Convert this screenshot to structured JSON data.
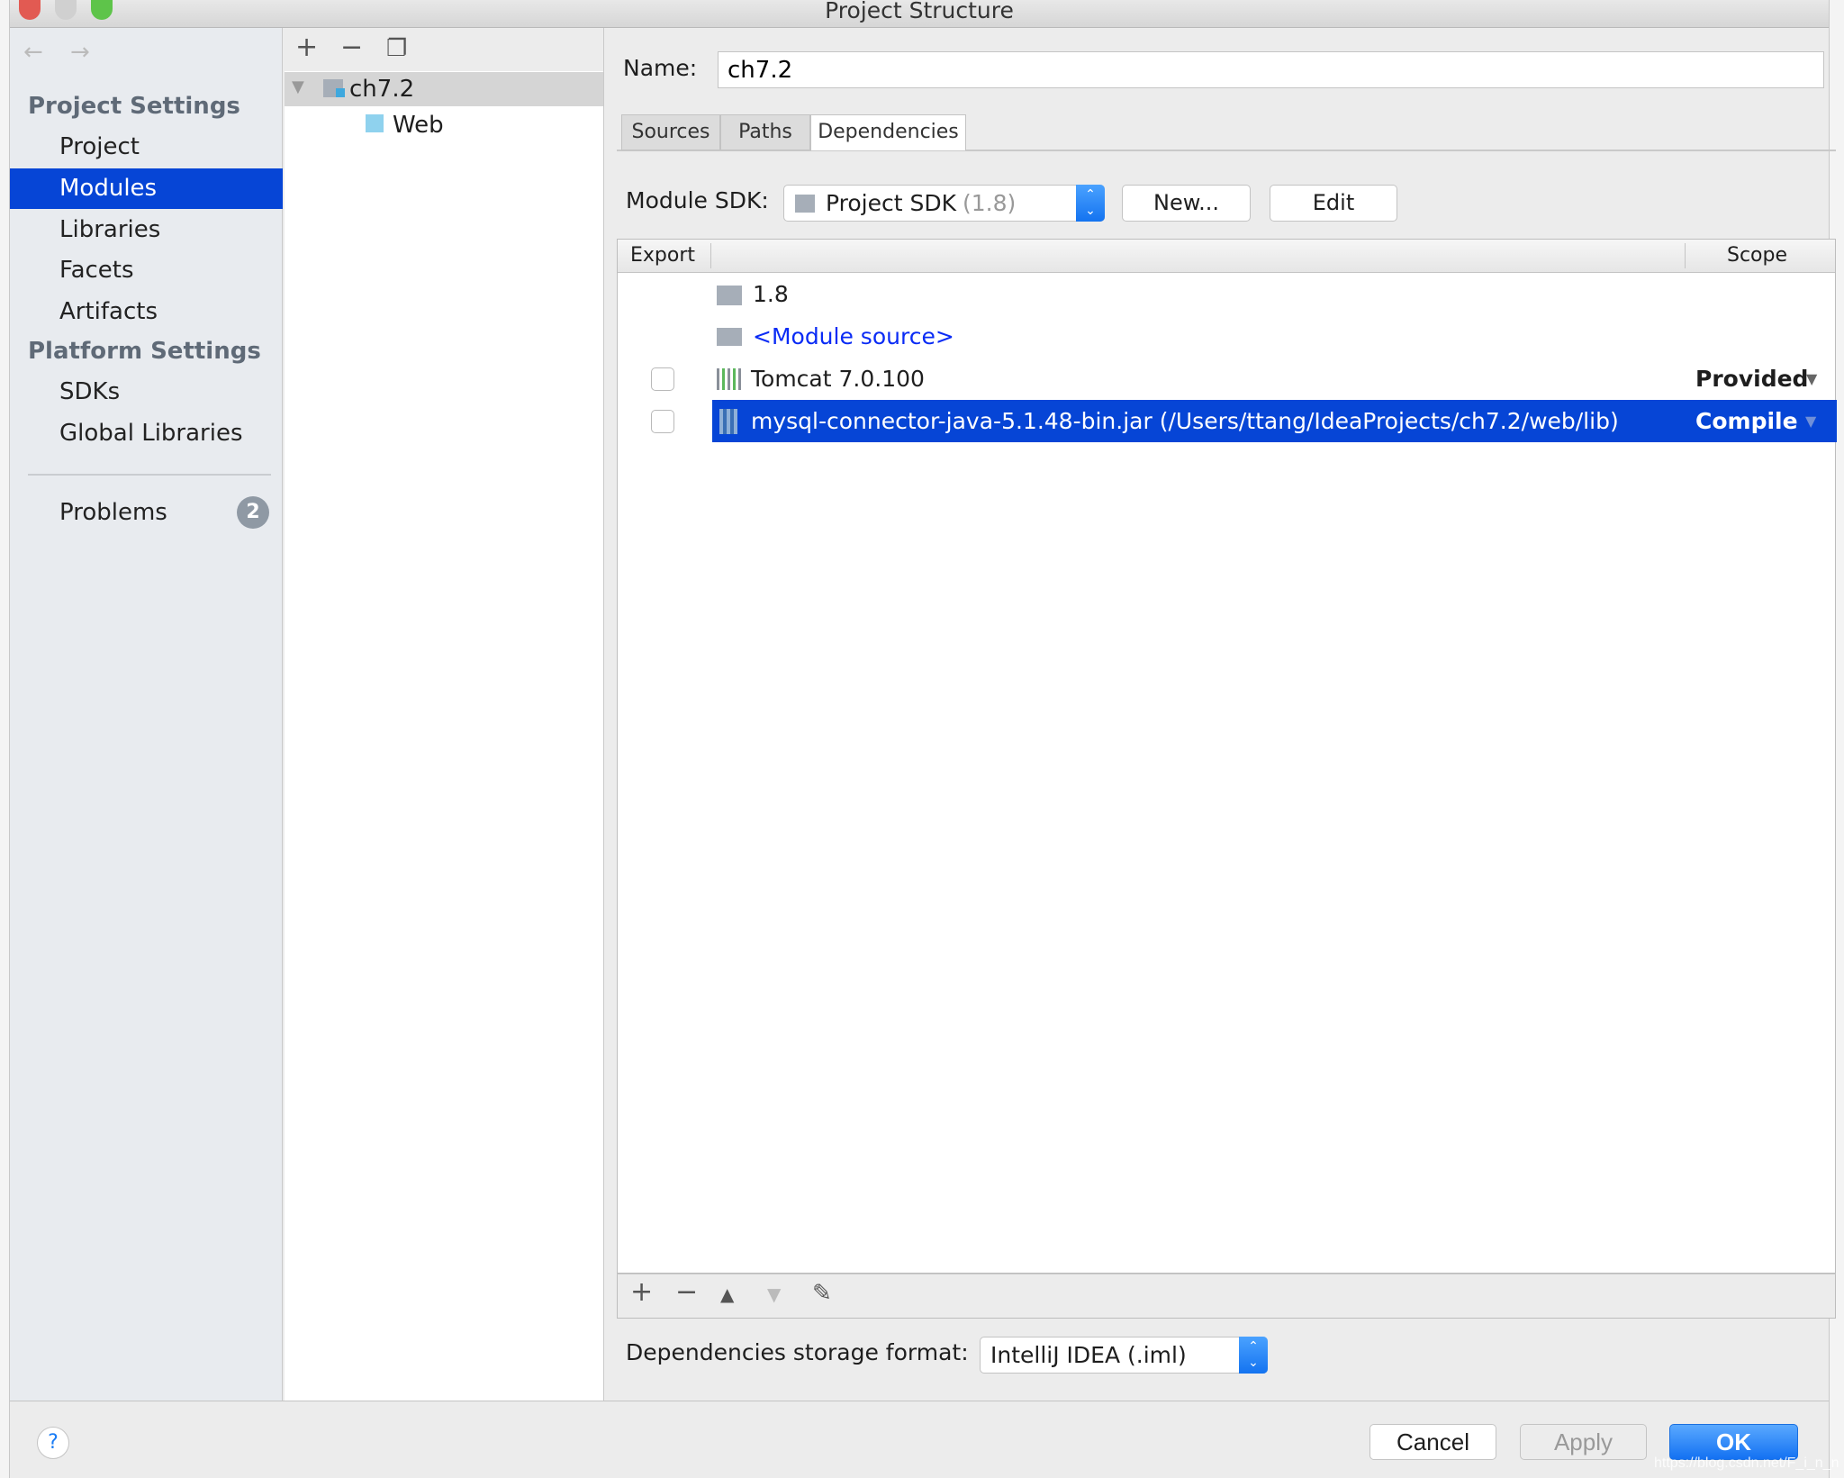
{
  "window": {
    "title": "Project Structure"
  },
  "sidebar": {
    "back_icon": "arrow-left-icon",
    "forward_icon": "arrow-right-icon",
    "project_settings_header": "Project Settings",
    "project_items": [
      {
        "label": "Project"
      },
      {
        "label": "Modules",
        "selected": true
      },
      {
        "label": "Libraries"
      },
      {
        "label": "Facets"
      },
      {
        "label": "Artifacts"
      }
    ],
    "platform_settings_header": "Platform Settings",
    "platform_items": [
      {
        "label": "SDKs"
      },
      {
        "label": "Global Libraries"
      }
    ],
    "problems": {
      "label": "Problems",
      "count": "2"
    }
  },
  "module_tree": {
    "toolbar": [
      "plus-icon",
      "minus-icon",
      "copy-icon"
    ],
    "root": {
      "label": "ch7.2",
      "expanded": true
    },
    "children": [
      {
        "label": "Web"
      }
    ]
  },
  "module": {
    "name_label": "Name:",
    "name_value": "ch7.2",
    "tabs": [
      {
        "label": "Sources"
      },
      {
        "label": "Paths"
      },
      {
        "label": "Dependencies",
        "selected": true
      }
    ],
    "sdk_label": "Module SDK:",
    "sdk_value": "Project SDK",
    "sdk_version": "(1.8)",
    "new_button": "New...",
    "edit_button": "Edit",
    "table": {
      "headers": {
        "export": "Export",
        "scope": "Scope"
      },
      "rows": [
        {
          "name": "1.8",
          "icon": "jdk-folder-icon",
          "scope": "",
          "checkbox": false
        },
        {
          "name": "<Module source>",
          "icon": "source-folder-icon",
          "scope": "",
          "checkbox": false,
          "link": true
        },
        {
          "name": "Tomcat 7.0.100",
          "icon": "library-icon",
          "scope": "Provided",
          "checkbox": true,
          "checked": false
        },
        {
          "name": "mysql-connector-java-5.1.48-bin.jar (/Users/ttang/IdeaProjects/ch7.2/web/lib)",
          "icon": "jar-icon",
          "scope": "Compile",
          "checkbox": true,
          "checked": false,
          "selected": true
        }
      ]
    },
    "table_toolbar": [
      "plus-icon",
      "minus-icon",
      "move-up-icon",
      "move-down-icon",
      "edit-icon"
    ],
    "storage_label": "Dependencies storage format:",
    "storage_value": "IntelliJ IDEA (.iml)"
  },
  "footer": {
    "help": "?",
    "cancel": "Cancel",
    "apply": "Apply",
    "ok": "OK",
    "watermark": "https://blog.csdn.net/F_i_n_n"
  },
  "colors": {
    "selection": "#0645d6",
    "link": "#0a2bf5",
    "ok_button": "#1a7cf5"
  }
}
